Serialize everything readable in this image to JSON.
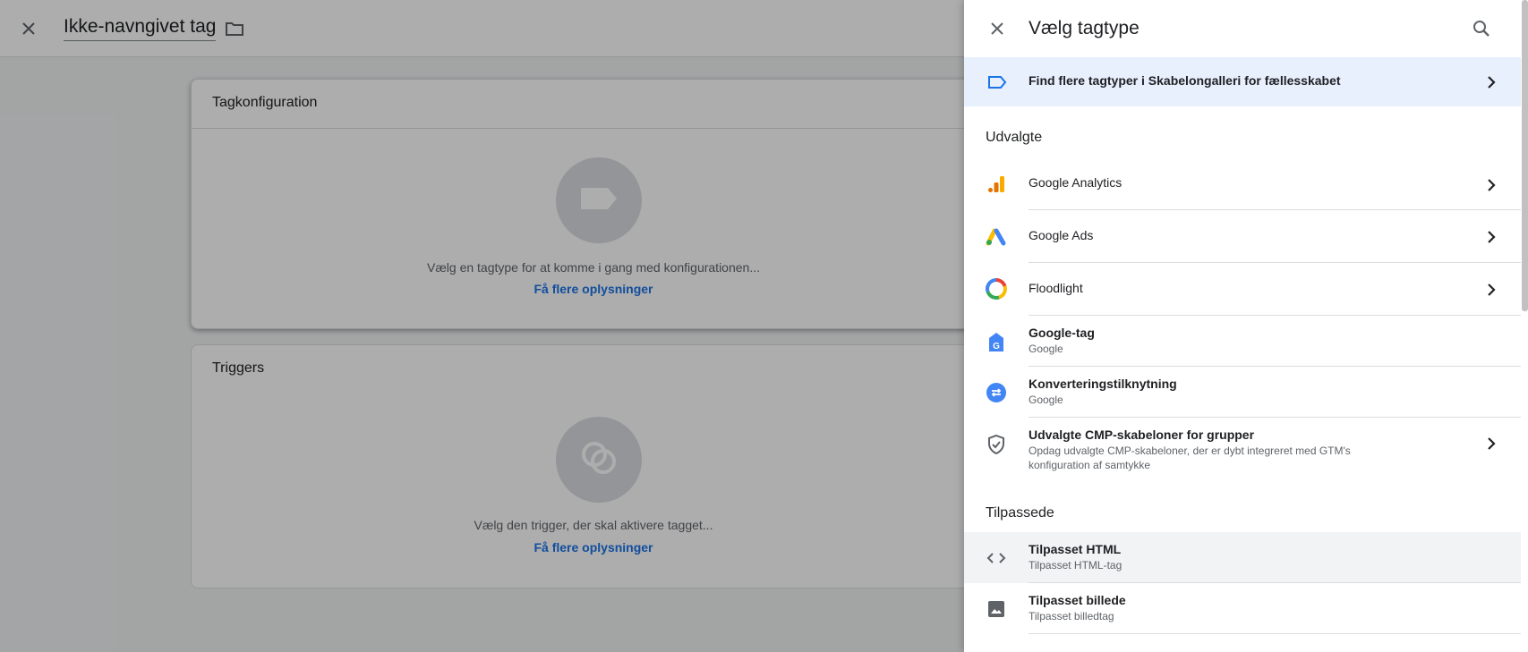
{
  "editor": {
    "tag_name": "Ikke-navngivet tag",
    "config_card": {
      "title": "Tagkonfiguration",
      "hint": "Vælg en tagtype for at komme i gang med konfigurationen...",
      "link": "Få flere oplysninger"
    },
    "triggers_card": {
      "title": "Triggers",
      "hint": "Vælg den trigger, der skal aktivere tagget...",
      "link": "Få flere oplysninger"
    }
  },
  "panel": {
    "title": "Vælg tagtype",
    "gallery_link": "Find flere tagtyper i Skabelongalleri for fællesskabet",
    "featured_heading": "Udvalgte",
    "featured": [
      {
        "label": "Google Analytics",
        "sub": "",
        "icon": "google-analytics-icon"
      },
      {
        "label": "Google Ads",
        "sub": "",
        "icon": "google-ads-icon"
      },
      {
        "label": "Floodlight",
        "sub": "",
        "icon": "floodlight-icon"
      },
      {
        "label": "Google-tag",
        "sub": "Google",
        "icon": "google-tag-icon"
      },
      {
        "label": "Konverteringstilknytning",
        "sub": "Google",
        "icon": "conversion-linker-icon"
      },
      {
        "label": "Udvalgte CMP-skabeloner for grupper",
        "sub": "Opdag udvalgte CMP-skabeloner, der er dybt integreret med GTM's konfiguration af samtykke",
        "icon": "shield-check-icon"
      }
    ],
    "custom_heading": "Tilpassede",
    "custom": [
      {
        "label": "Tilpasset HTML",
        "sub": "Tilpasset HTML-tag",
        "icon": "code-icon"
      },
      {
        "label": "Tilpasset billede",
        "sub": "Tilpasset billedtag",
        "icon": "image-icon"
      }
    ]
  },
  "colors": {
    "accent": "#1a73e8",
    "gallery_bg": "#e8f0fe",
    "highlight_bg": "#f1f3f4"
  }
}
